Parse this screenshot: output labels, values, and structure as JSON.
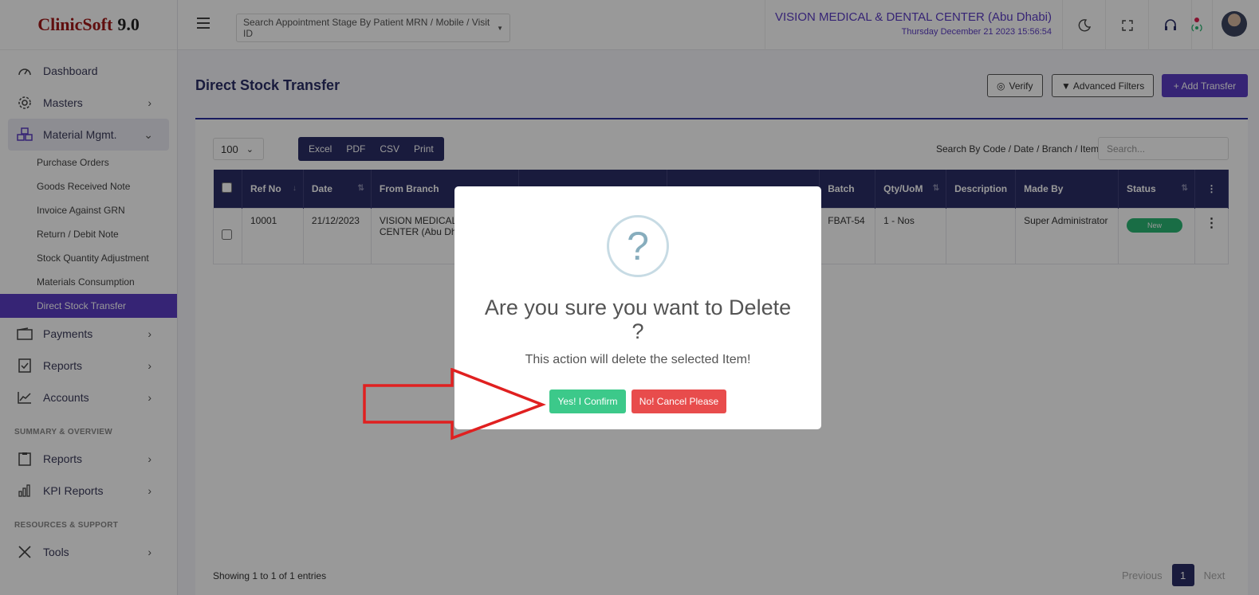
{
  "app": {
    "logo_part1": "ClinicSoft",
    "logo_part2": "9.0"
  },
  "sidebar": {
    "items": [
      {
        "label": "Dashboard",
        "icon": "dashboard-icon"
      },
      {
        "label": "Masters",
        "icon": "gear-icon"
      },
      {
        "label": "Material Mgmt.",
        "icon": "boxes-icon"
      }
    ],
    "sub_items": [
      "Purchase Orders",
      "Goods Received Note",
      "Invoice Against GRN",
      "Return / Debit Note",
      "Stock Quantity Adjustment",
      "Materials Consumption",
      "Direct Stock Transfer"
    ],
    "items_after": [
      {
        "label": "Payments",
        "icon": "wallet-icon"
      },
      {
        "label": "Reports",
        "icon": "report-icon"
      },
      {
        "label": "Accounts",
        "icon": "chart-line-icon"
      }
    ],
    "section1": "SUMMARY & OVERVIEW",
    "section1_items": [
      {
        "label": "Reports",
        "icon": "clipboard-icon"
      },
      {
        "label": "KPI Reports",
        "icon": "bar-chart-icon"
      }
    ],
    "section2": "RESOURCES & SUPPORT",
    "section2_items": [
      {
        "label": "Tools",
        "icon": "tools-icon"
      }
    ]
  },
  "topbar": {
    "search_placeholder": "Search Appointment Stage By Patient MRN / Mobile / Visit ID",
    "center_name": "VISION MEDICAL & DENTAL CENTER (Abu Dhabi)",
    "datetime": "Thursday December 21 2023 15:56:54"
  },
  "page": {
    "title": "Direct Stock Transfer",
    "verify_label": "Verify",
    "filters_label": "Advanced Filters",
    "add_label": "+ Add Transfer",
    "page_size": "100",
    "export": [
      "Excel",
      "PDF",
      "CSV",
      "Print"
    ],
    "search_label": "Search By Code / Date / Branch / Item",
    "search_placeholder": "Search..."
  },
  "table": {
    "headers": [
      "Ref No",
      "Date",
      "From Branch",
      "",
      "",
      "Batch",
      "Qty/UoM",
      "Description",
      "Made By",
      "Status"
    ],
    "rows": [
      {
        "ref": "10001",
        "date": "21/12/2023",
        "from_branch": "VISION MEDICAL & DENTAL CENTER (Abu Dhabi)",
        "batch": "FBAT-54",
        "qty": "1 - Nos",
        "description": "",
        "made_by": "Super Administrator",
        "status": "New"
      }
    ]
  },
  "footer": {
    "showing": "Showing 1 to 1 of 1 entries",
    "previous": "Previous",
    "page": "1",
    "next": "Next"
  },
  "modal": {
    "icon": "?",
    "title": "Are you sure you want to Delete ?",
    "text": "This action will delete the selected Item!",
    "confirm_label": "Yes! I Confirm",
    "cancel_label": "No! Cancel Please"
  },
  "colors": {
    "primary": "#5b3cc4",
    "navy": "#2b2e66",
    "success": "#3cc98a",
    "danger": "#e84c4c",
    "arrow": "#e02020"
  }
}
